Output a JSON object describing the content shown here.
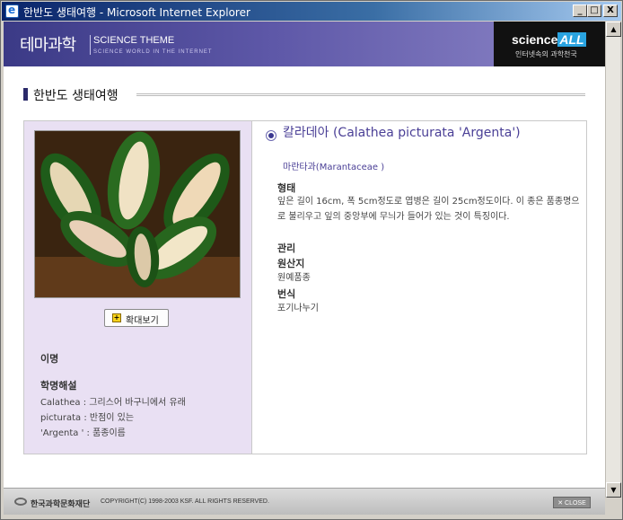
{
  "window": {
    "title": "한반도 생태여행 - Microsoft Internet Explorer",
    "buttons": {
      "minimize": "_",
      "maximize": "□",
      "close": "X"
    }
  },
  "banner": {
    "logo": "테마과학",
    "subtitle": "SCIENCE THEME",
    "tagline": "SCIENCE WORLD IN THE INTERNET",
    "brand_name": "science",
    "brand_accent": "ALL",
    "brand_slogan": "인터넷속의 과학천국"
  },
  "page": {
    "heading": "한반도 생태여행"
  },
  "left": {
    "zoom_label": "확대보기",
    "alias_label": "이명",
    "etymology_label": "학명해설",
    "etymology_lines": [
      "Calathea : 그리스어 바구니에서 유래",
      "picturata : 반점이 있는",
      "'Argenta ' : 품종이름"
    ]
  },
  "plant": {
    "name": "칼라데아 (Calathea picturata 'Argenta')",
    "family": "마란타과(Marantaceae )",
    "sections": [
      {
        "title": "형태",
        "body": "잎은 길이 16cm, 폭 5cm정도로 엽병은 길이 25cm정도이다. 이 종은 품종명으로 불리우고 잎의 중앙부에 무늬가 들어가 있는 것이 특징이다."
      },
      {
        "title": "관리",
        "body": ""
      },
      {
        "title": "원산지",
        "body": "원예품종"
      },
      {
        "title": "번식",
        "body": "포기나누기"
      }
    ]
  },
  "footer": {
    "org": "한국과학문화재단",
    "copyright": "COPYRIGHT(C) 1998-2003 KSF. ALL RIGHTS RESERVED.",
    "close_label": "CLOSE"
  },
  "colors": {
    "banner": "#5e58a8",
    "accent": "#4a3f96",
    "side_panel": "#e9e0f3"
  }
}
